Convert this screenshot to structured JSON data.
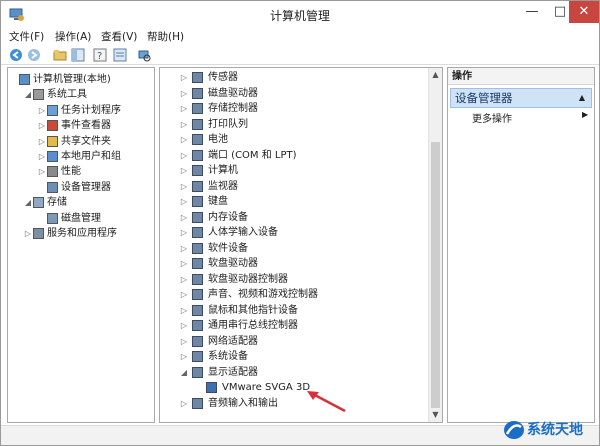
{
  "window": {
    "title": "计算机管理"
  },
  "menu": [
    {
      "label": "文件(F)"
    },
    {
      "label": "操作(A)"
    },
    {
      "label": "查看(V)"
    },
    {
      "label": "帮助(H)"
    }
  ],
  "left_tree": [
    {
      "label": "计算机管理(本地)",
      "icon": "computer-management-icon",
      "level": 0,
      "expander": ""
    },
    {
      "label": "系统工具",
      "icon": "system-tools-icon",
      "level": 1,
      "expander": "◢"
    },
    {
      "label": "任务计划程序",
      "icon": "task-scheduler-icon",
      "level": 2,
      "expander": "▷"
    },
    {
      "label": "事件查看器",
      "icon": "event-viewer-icon",
      "level": 2,
      "expander": "▷"
    },
    {
      "label": "共享文件夹",
      "icon": "shared-folder-icon",
      "level": 2,
      "expander": "▷"
    },
    {
      "label": "本地用户和组",
      "icon": "users-icon",
      "level": 2,
      "expander": "▷"
    },
    {
      "label": "性能",
      "icon": "performance-icon",
      "level": 2,
      "expander": "▷"
    },
    {
      "label": "设备管理器",
      "icon": "device-manager-icon",
      "level": 2,
      "expander": ""
    },
    {
      "label": "存储",
      "icon": "storage-icon",
      "level": 1,
      "expander": "◢"
    },
    {
      "label": "磁盘管理",
      "icon": "disk-management-icon",
      "level": 2,
      "expander": ""
    },
    {
      "label": "服务和应用程序",
      "icon": "services-icon",
      "level": 1,
      "expander": "▷"
    }
  ],
  "device_tree": [
    {
      "label": "传感器",
      "icon": "sensor-icon",
      "expanded": false,
      "level": 0
    },
    {
      "label": "磁盘驱动器",
      "icon": "disk-drive-icon",
      "expanded": false,
      "level": 0
    },
    {
      "label": "存储控制器",
      "icon": "storage-controller-icon",
      "expanded": false,
      "level": 0
    },
    {
      "label": "打印队列",
      "icon": "print-queue-icon",
      "expanded": false,
      "level": 0
    },
    {
      "label": "电池",
      "icon": "battery-icon",
      "expanded": false,
      "level": 0
    },
    {
      "label": "端口 (COM 和 LPT)",
      "icon": "port-icon",
      "expanded": false,
      "level": 0
    },
    {
      "label": "计算机",
      "icon": "computer-icon",
      "expanded": false,
      "level": 0
    },
    {
      "label": "监视器",
      "icon": "monitor-icon",
      "expanded": false,
      "level": 0
    },
    {
      "label": "键盘",
      "icon": "keyboard-icon",
      "expanded": false,
      "level": 0
    },
    {
      "label": "内存设备",
      "icon": "memory-icon",
      "expanded": false,
      "level": 0
    },
    {
      "label": "人体学输入设备",
      "icon": "hid-icon",
      "expanded": false,
      "level": 0
    },
    {
      "label": "软件设备",
      "icon": "software-device-icon",
      "expanded": false,
      "level": 0
    },
    {
      "label": "软盘驱动器",
      "icon": "floppy-drive-icon",
      "expanded": false,
      "level": 0
    },
    {
      "label": "软盘驱动器控制器",
      "icon": "floppy-controller-icon",
      "expanded": false,
      "level": 0
    },
    {
      "label": "声音、视频和游戏控制器",
      "icon": "sound-icon",
      "expanded": false,
      "level": 0
    },
    {
      "label": "鼠标和其他指针设备",
      "icon": "mouse-icon",
      "expanded": false,
      "level": 0
    },
    {
      "label": "通用串行总线控制器",
      "icon": "usb-icon",
      "expanded": false,
      "level": 0
    },
    {
      "label": "网络适配器",
      "icon": "network-adapter-icon",
      "expanded": false,
      "level": 0
    },
    {
      "label": "系统设备",
      "icon": "system-device-icon",
      "expanded": false,
      "level": 0
    },
    {
      "label": "显示适配器",
      "icon": "display-adapter-icon",
      "expanded": true,
      "level": 0
    },
    {
      "label": "VMware SVGA 3D",
      "icon": "display-device-icon",
      "expanded": null,
      "level": 1
    },
    {
      "label": "音频输入和输出",
      "icon": "audio-io-icon",
      "expanded": false,
      "level": 0
    }
  ],
  "actions": {
    "header": "操作",
    "section": "设备管理器",
    "more": "更多操作"
  },
  "watermark": "系统天地",
  "colors": {
    "close_button": "#c7463f",
    "selected_section": "#cfe3f7",
    "annotation_arrow": "#d9303a"
  }
}
